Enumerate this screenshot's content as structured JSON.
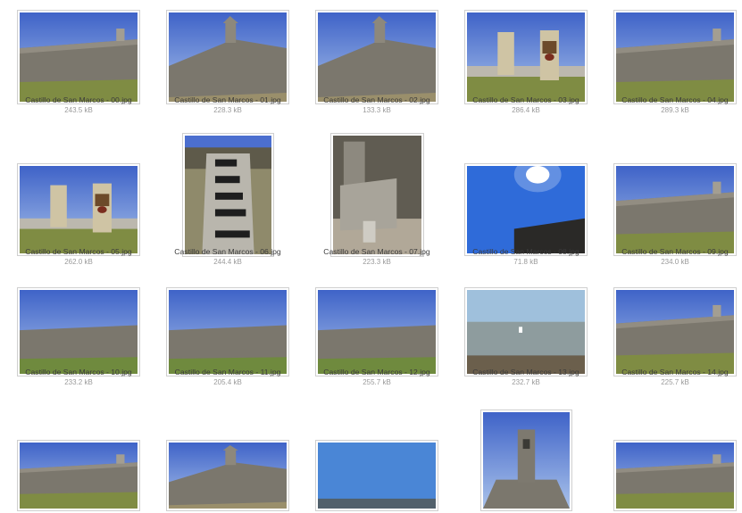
{
  "files": [
    {
      "name": "Castillo de San Marcos - 00.jpg",
      "size": "243.5 kB"
    },
    {
      "name": "Castillo de San Marcos - 01.jpg",
      "size": "228.3 kB"
    },
    {
      "name": "Castillo de San Marcos - 02.jpg",
      "size": "133.3 kB"
    },
    {
      "name": "Castillo de San Marcos - 03.jpg",
      "size": "286.4 kB"
    },
    {
      "name": "Castillo de San Marcos - 04.jpg",
      "size": "289.3 kB"
    },
    {
      "name": "Castillo de San Marcos - 05.jpg",
      "size": "262.0 kB"
    },
    {
      "name": "Castillo de San Marcos - 06.jpg",
      "size": "244.4 kB"
    },
    {
      "name": "Castillo de San Marcos - 07.jpg",
      "size": "223.3 kB"
    },
    {
      "name": "Castillo de San Marcos - 08.jpg",
      "size": "71.8 kB"
    },
    {
      "name": "Castillo de San Marcos - 09.jpg",
      "size": "234.0 kB"
    },
    {
      "name": "Castillo de San Marcos - 10.jpg",
      "size": "233.2 kB"
    },
    {
      "name": "Castillo de San Marcos - 11.jpg",
      "size": "205.4 kB"
    },
    {
      "name": "Castillo de San Marcos - 12.jpg",
      "size": "255.7 kB"
    },
    {
      "name": "Castillo de San Marcos - 13.jpg",
      "size": "232.7 kB"
    },
    {
      "name": "Castillo de San Marcos - 14.jpg",
      "size": "225.7 kB"
    },
    {
      "name": "",
      "size": ""
    },
    {
      "name": "",
      "size": ""
    },
    {
      "name": "",
      "size": ""
    },
    {
      "name": "",
      "size": ""
    },
    {
      "name": "",
      "size": ""
    }
  ]
}
